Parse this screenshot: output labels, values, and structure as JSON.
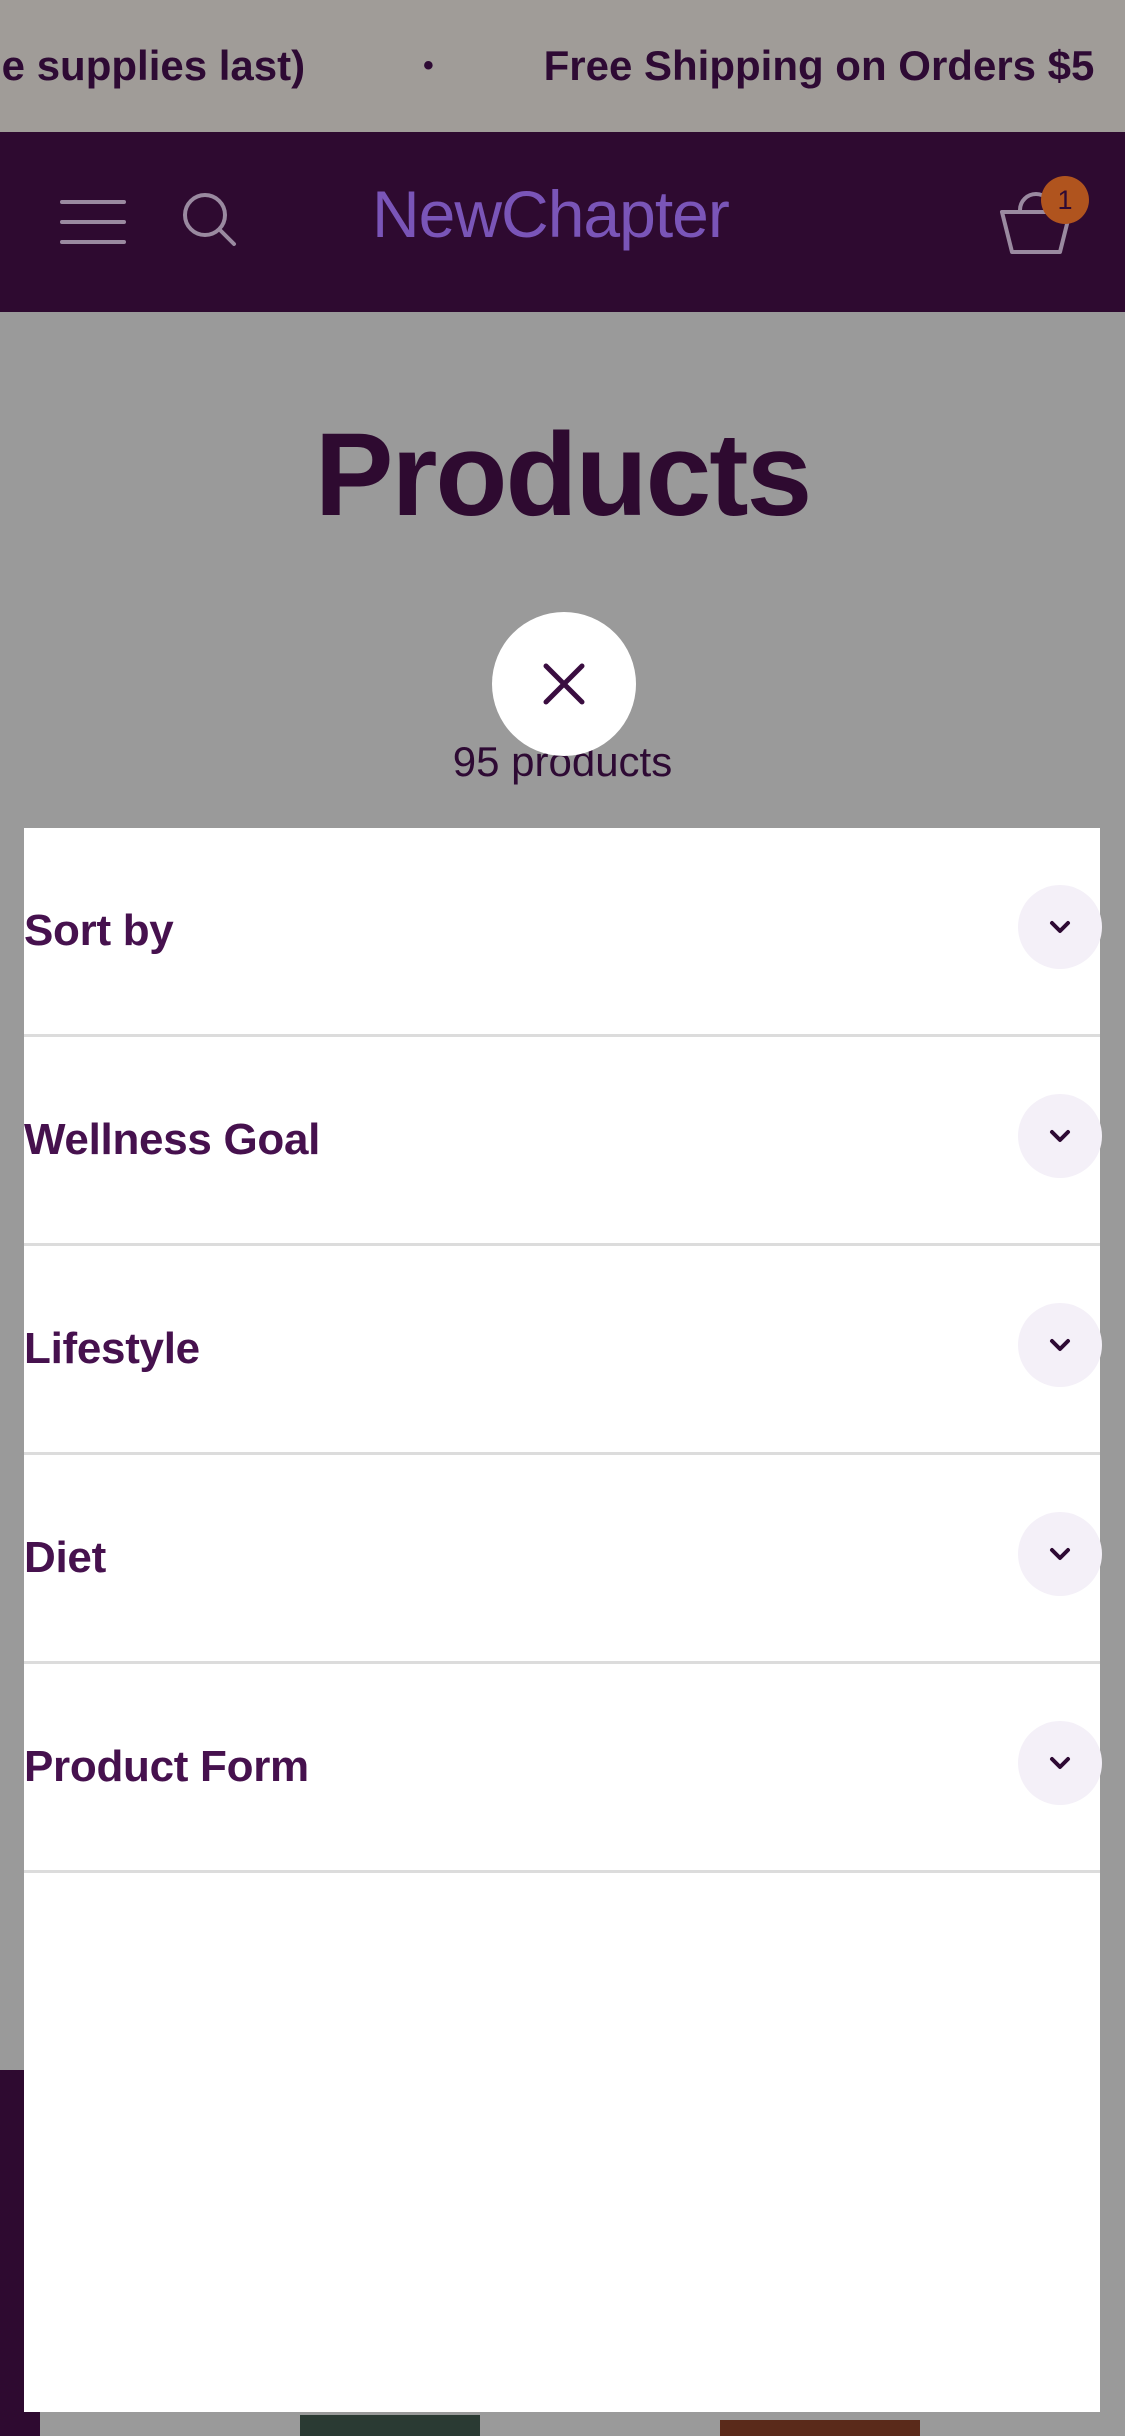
{
  "announcement": {
    "text_a": "le supplies last)",
    "separator": "•",
    "text_b": "Free Shipping on Orders $5"
  },
  "header": {
    "logo": "NewChapter",
    "menu_icon": "hamburger-menu-icon",
    "search_icon": "search-icon",
    "cart_icon": "basket-icon",
    "cart_count": "1"
  },
  "page": {
    "title": "Products",
    "product_count": "95 products"
  },
  "filters": {
    "close_icon": "close-icon",
    "items": [
      {
        "label": "Sort by"
      },
      {
        "label": "Wellness Goal"
      },
      {
        "label": "Lifestyle"
      },
      {
        "label": "Diet"
      },
      {
        "label": "Product Form"
      }
    ]
  },
  "colors": {
    "brand_dark": "#2e0a30",
    "brand_purple": "#7a55b8",
    "badge": "#b0541e",
    "overlay": "#9a9a9a"
  }
}
